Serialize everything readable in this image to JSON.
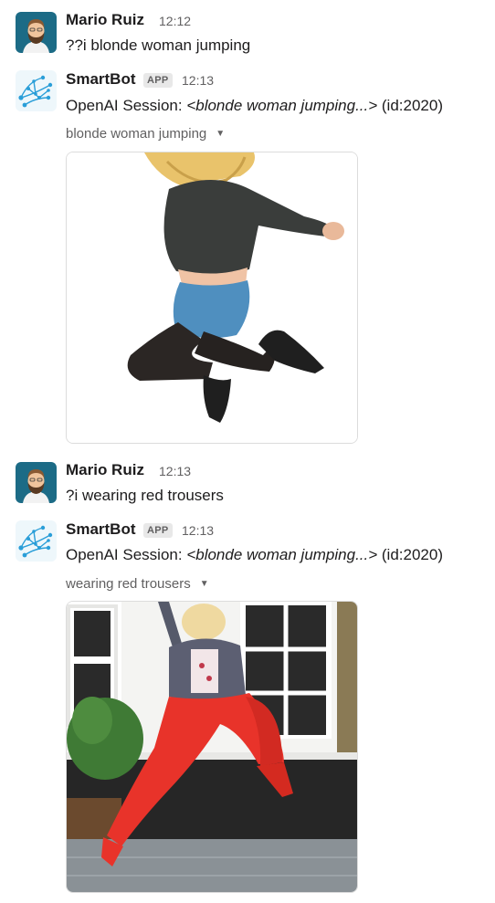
{
  "messages": [
    {
      "author": "Mario Ruiz",
      "time": "12:12",
      "text": "??i blonde woman jumping"
    },
    {
      "author": "SmartBot",
      "badge": "APP",
      "time": "12:13",
      "text_prefix": "OpenAI Session: ",
      "text_italic": "<blonde woman jumping...>",
      "text_suffix": " (id:2020)",
      "attachment_label": "blonde woman jumping"
    },
    {
      "author": "Mario Ruiz",
      "time": "12:13",
      "text": "?i wearing red trousers"
    },
    {
      "author": "SmartBot",
      "badge": "APP",
      "time": "12:13",
      "text_prefix": "OpenAI Session: ",
      "text_italic": "<blonde woman jumping...>",
      "text_suffix": " (id:2020)",
      "attachment_label": "wearing red trousers"
    }
  ],
  "icons": {
    "user_avatar": "bearded-man-avatar",
    "bot_avatar": "neural-network-avatar",
    "caret": "caret-down-icon"
  },
  "colors": {
    "username": "#1d1c1d",
    "meta": "#616061",
    "badge_bg": "#e8e8e8",
    "avatar_bg": "#1c6b86",
    "bot_icon": "#2a9ed8"
  }
}
